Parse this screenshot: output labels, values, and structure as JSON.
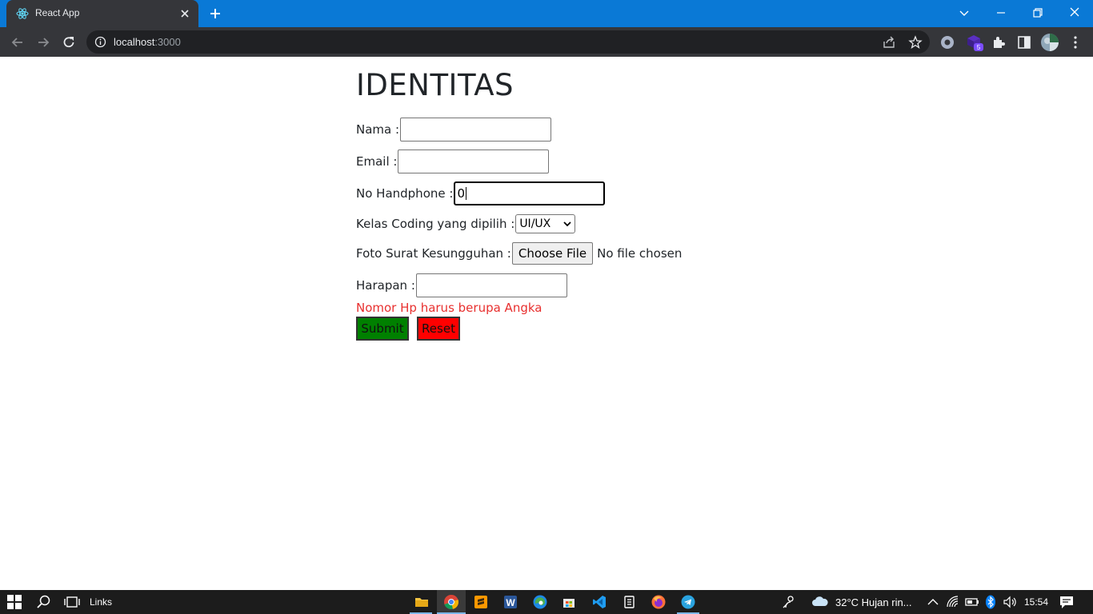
{
  "browser": {
    "tab_title": "React App",
    "url_host": "localhost",
    "url_port": ":3000",
    "extension_badge": "5"
  },
  "page": {
    "heading": "IDENTITAS",
    "fields": {
      "nama_label": "Nama :",
      "nama_value": "",
      "email_label": "Email :",
      "email_value": "",
      "hp_label": "No Handphone :",
      "hp_value": "0",
      "kelas_label": "Kelas Coding yang dipilih :",
      "kelas_selected": "UI/UX",
      "foto_label": "Foto Surat Kesungguhan :",
      "file_button": "Choose File",
      "file_status": "No file chosen",
      "harapan_label": "Harapan :",
      "harapan_value": ""
    },
    "error_message": "Nomor Hp harus berupa Angka",
    "submit_label": "Submit",
    "reset_label": "Reset"
  },
  "taskbar": {
    "links_label": "Links",
    "weather": "32°C  Hujan rin...",
    "time": "15:54"
  },
  "colors": {
    "tabbar": "#0a79d6",
    "chrome_dark": "#35363a",
    "error": "#e8302f",
    "submit_bg": "#008000",
    "reset_bg": "#ff0000"
  }
}
